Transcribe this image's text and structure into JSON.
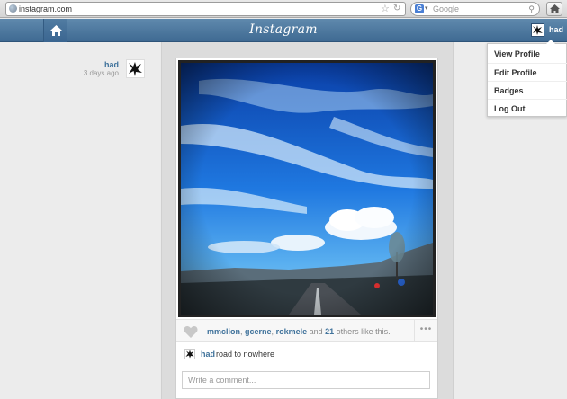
{
  "browser": {
    "url": "instagram.com",
    "search_placeholder": "Google",
    "search_engine_letter": "G"
  },
  "header": {
    "logo": "Instagram",
    "username": "had"
  },
  "dropdown": {
    "items": [
      {
        "label": "View Profile"
      },
      {
        "label": "Edit Profile"
      },
      {
        "label": "Badges"
      },
      {
        "label": "Log Out"
      }
    ]
  },
  "post": {
    "username": "had",
    "time_ago": "3 days ago",
    "likes": {
      "users": [
        "mmclion",
        "gcerne",
        "rokmele"
      ],
      "separator": ", ",
      "and_text": " and ",
      "others_count": "21",
      "suffix": " others like this."
    },
    "caption_user": "had",
    "caption_text": "road to nowhere",
    "comment_placeholder": "Write a comment..."
  },
  "colors": {
    "header": "#4a76a0",
    "link": "#3f729b",
    "page_bg": "#ebebeb"
  },
  "icons": [
    "globe-icon",
    "star-icon",
    "reload-icon",
    "search-icon",
    "home-icon",
    "avatar",
    "heart-icon",
    "more-icon"
  ]
}
